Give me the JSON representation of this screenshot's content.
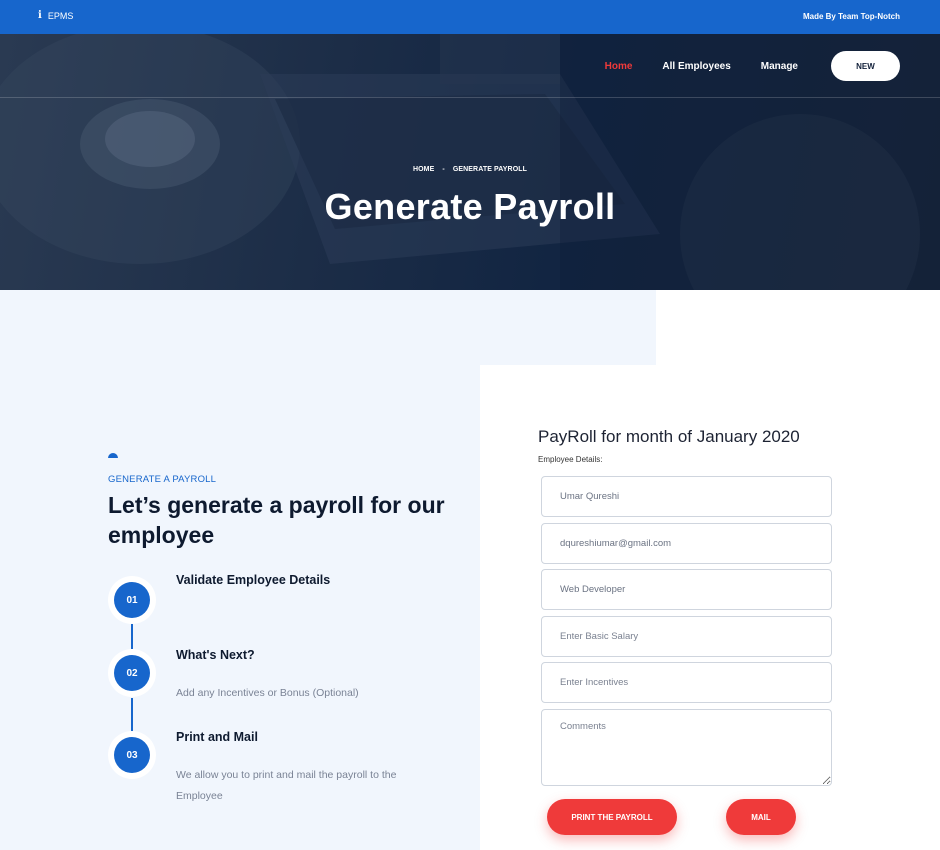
{
  "topbar": {
    "brand": "EPMS",
    "brand_icon": "info-icon",
    "made_by": "Made By Team Top-Notch"
  },
  "nav": {
    "items": [
      "Home",
      "All Employees",
      "Manage"
    ],
    "active": "Home",
    "new_button": "NEW"
  },
  "hero": {
    "breadcrumb_home": "HOME",
    "breadcrumb_sep": "-",
    "breadcrumb_current": "GENERATE PAYROLL",
    "title": "Generate Payroll"
  },
  "intro": {
    "eyebrow": "GENERATE A PAYROLL",
    "headline": "Let’s generate a payroll for our employee",
    "steps": [
      {
        "number": "01",
        "title": "Validate Employee Details",
        "desc": ""
      },
      {
        "number": "02",
        "title": "What's Next?",
        "desc": "Add any Incentives or Bonus (Optional)"
      },
      {
        "number": "03",
        "title": "Print and Mail",
        "desc": "We allow you to print and mail the payroll to the Employee"
      }
    ]
  },
  "form": {
    "title": "PayRoll for month of January 2020",
    "subtitle": "Employee Details:",
    "name_value": "Umar Qureshi",
    "email_value": "dqureshiumar@gmail.com",
    "role_value": "Web Developer",
    "salary_placeholder": "Enter Basic Salary",
    "incentives_placeholder": "Enter Incentives",
    "comments_placeholder": "Comments",
    "print_button": "PRINT THE PAYROLL",
    "mail_button": "MAIL"
  },
  "colors": {
    "primary": "#1766cc",
    "accent": "#ef3a3a",
    "hero_dark": "#122542",
    "light_bg": "#f1f6fd"
  }
}
